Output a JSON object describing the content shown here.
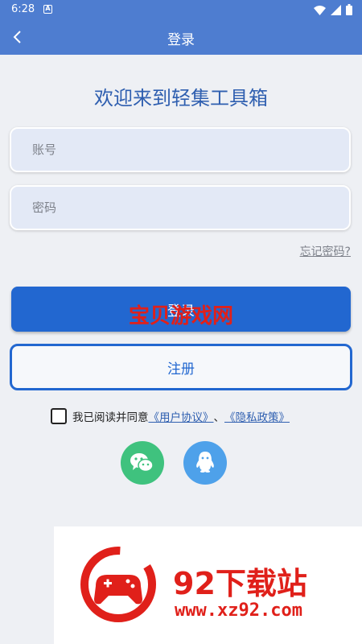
{
  "status_bar": {
    "time": "6:28",
    "notification_glyph": "A"
  },
  "app_bar": {
    "title": "登录",
    "back_icon": "chevron-left-icon"
  },
  "welcome": "欢迎来到轻集工具箱",
  "form": {
    "account_placeholder": "账号",
    "password_placeholder": "密码",
    "forgot_label": "忘记密码?",
    "login_label": "登录",
    "register_label": "注册"
  },
  "agreement": {
    "prefix": "我已阅读并同意",
    "user_agreement": "《用户协议》",
    "separator": "、",
    "privacy_policy": "《隐私政策》",
    "checked": false
  },
  "social": [
    "wechat-icon",
    "qq-icon"
  ],
  "overlay_watermark": "宝贝游戏网",
  "ad": {
    "brand": "92下载站",
    "url": "www.xz92.com"
  },
  "colors": {
    "primary": "#2267d0",
    "header": "#4e7dd0",
    "wechat": "#3fc27e",
    "qq": "#4ea1ea",
    "ad_red": "#e0201a"
  }
}
